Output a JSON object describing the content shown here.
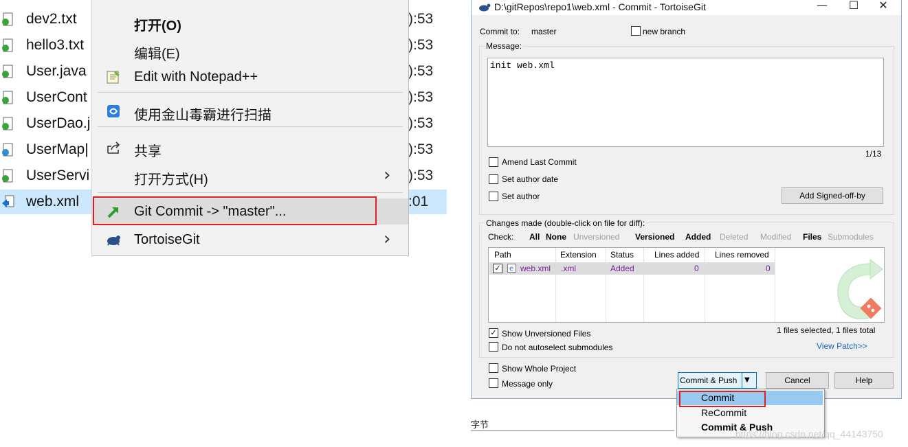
{
  "explorer": {
    "files": [
      {
        "name": "dev2.txt",
        "time": "):53",
        "icon": "text-file-icon"
      },
      {
        "name": "hello3.txt",
        "time": "):53",
        "icon": "text-file-icon"
      },
      {
        "name": "User.java",
        "time": "):53",
        "icon": "java-file-icon"
      },
      {
        "name": "UserCont",
        "time": "):53",
        "icon": "java-file-icon"
      },
      {
        "name": "UserDao.j",
        "time": "):53",
        "icon": "java-file-icon"
      },
      {
        "name": "UserMap|",
        "time": "):53",
        "icon": "java-file-icon"
      },
      {
        "name": "UserServi",
        "time": "):53",
        "icon": "java-file-icon"
      },
      {
        "name": "web.xml",
        "time": ":01",
        "icon": "xml-file-icon"
      }
    ]
  },
  "context_menu": {
    "open": "打开(O)",
    "edit": "编辑(E)",
    "edit_notepad": "Edit with Notepad++",
    "scan": "使用金山毒霸进行扫描",
    "share": "共享",
    "open_with": "打开方式(H)",
    "git_commit": "Git Commit -> \"master\"...",
    "tortoisegit": "TortoiseGit"
  },
  "dialog": {
    "title": "D:\\gitRepos\\repo1\\web.xml - Commit - TortoiseGit",
    "commit_to_label": "Commit to:",
    "branch": "master",
    "new_branch_label": "new branch",
    "message_label": "Message:",
    "message": "init web.xml",
    "char_count": "1/13",
    "amend_label": "Amend Last Commit",
    "author_date_label": "Set author date",
    "set_author_label": "Set author",
    "signed_off_button": "Add Signed-off-by",
    "changes_label": "Changes made (double-click on file for diff):",
    "check_label": "Check:",
    "filters": {
      "all": "All",
      "none": "None",
      "unversioned": "Unversioned",
      "versioned": "Versioned",
      "added": "Added",
      "deleted": "Deleted",
      "modified": "Modified",
      "files": "Files",
      "submodules": "Submodules"
    },
    "columns": {
      "path": "Path",
      "extension": "Extension",
      "status": "Status",
      "lines_added": "Lines added",
      "lines_removed": "Lines removed"
    },
    "file_row": {
      "path": "web.xml",
      "extension": ".xml",
      "status": "Added",
      "lines_added": "0",
      "lines_removed": "0"
    },
    "show_unversioned_label": "Show Unversioned Files",
    "selection_summary": "1 files selected, 1 files total",
    "no_autoselect_label": "Do not autoselect submodules",
    "view_patch": "View Patch>>",
    "show_whole_label": "Show Whole Project",
    "message_only_label": "Message only",
    "commit_push_button": "Commit & Push",
    "cancel_button": "Cancel",
    "help_button": "Help"
  },
  "dropdown": {
    "items": [
      "Commit",
      "ReCommit",
      "Commit & Push"
    ]
  },
  "footer": {
    "label": "字节",
    "watermark": "https://blog.csdn.net/qq_44143750"
  },
  "colors": {
    "selection_blue": "#cce8ff",
    "highlight_red": "#e02020",
    "added_purple": "#7a1f9e",
    "link_blue": "#1a63c9",
    "dropdown_highlight": "#99c9ef"
  }
}
